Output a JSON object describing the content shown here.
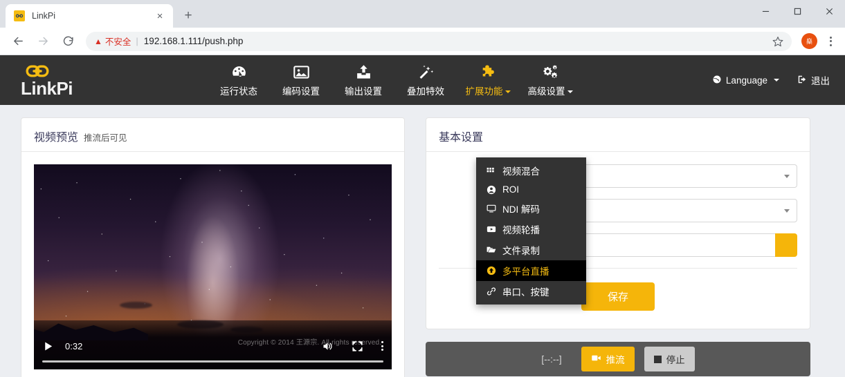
{
  "browser": {
    "tab": {
      "title": "LinkPi",
      "favicon_icon": "link-chain-icon",
      "close_icon": "×"
    },
    "new_tab_label": "+",
    "window": {
      "minimize": "minimize-icon",
      "maximize": "maximize-icon",
      "close": "close-icon"
    },
    "nav": {
      "back": "back-arrow-icon",
      "forward": "forward-arrow-icon",
      "reload": "reload-icon"
    },
    "omnibox": {
      "warning_icon": "warning-triangle-icon",
      "warning_text": "不安全",
      "separator": "|",
      "url": "192.168.1.111/push.php"
    },
    "bookmark_icon": "star-icon",
    "profile_initial": "燊",
    "menu_icon": "kebab-menu-icon"
  },
  "app": {
    "brand": {
      "name": "LinkPi",
      "icon": "chain-link-icon"
    },
    "nav_items": [
      {
        "label": "运行状态",
        "icon": "dashboard-icon",
        "active": false,
        "has_caret": false
      },
      {
        "label": "编码设置",
        "icon": "image-icon",
        "active": false,
        "has_caret": false
      },
      {
        "label": "输出设置",
        "icon": "upload-icon",
        "active": false,
        "has_caret": false
      },
      {
        "label": "叠加特效",
        "icon": "magic-wand-icon",
        "active": false,
        "has_caret": false
      },
      {
        "label": "扩展功能",
        "icon": "puzzle-piece-icon",
        "active": true,
        "has_caret": true
      },
      {
        "label": "高级设置",
        "icon": "gears-icon",
        "active": false,
        "has_caret": true
      }
    ],
    "language": {
      "label": "Language",
      "icon": "globe-icon",
      "has_caret": true
    },
    "logout": {
      "label": "退出",
      "icon": "sign-out-icon"
    },
    "accent_color": "#f5b50a",
    "navbar_color": "#333333",
    "page_bg_color": "#eceef2"
  },
  "dropdown": {
    "items": [
      {
        "label": "视频混合",
        "icon": "grid-icon",
        "selected": false
      },
      {
        "label": "ROI",
        "icon": "user-circle-icon",
        "selected": false
      },
      {
        "label": "NDI 解码",
        "icon": "monitor-icon",
        "selected": false
      },
      {
        "label": "视频轮播",
        "icon": "video-play-icon",
        "selected": false
      },
      {
        "label": "文件录制",
        "icon": "folder-open-icon",
        "selected": false
      },
      {
        "label": "多平台直播",
        "icon": "arrow-circle-up-icon",
        "selected": true
      },
      {
        "label": "串口、按键",
        "icon": "link-icon",
        "selected": false
      }
    ]
  },
  "preview": {
    "title": "视频预览",
    "subtitle": "推流后可见",
    "player": {
      "play_icon": "play-icon",
      "time": "0:32",
      "volume_icon": "volume-icon",
      "fullscreen_icon": "fullscreen-icon",
      "menu_icon": "kebab-menu-icon",
      "watermark": "Copyright © 2014 王源宗. All rights reserved."
    }
  },
  "settings": {
    "title": "基本设置",
    "rows": [
      {
        "label": "",
        "type": "select",
        "value": ""
      },
      {
        "label": "",
        "type": "select",
        "value": ""
      },
      {
        "label": "",
        "type": "input",
        "value": "",
        "button_label": ""
      }
    ],
    "save_label": "保存"
  },
  "statusbar": {
    "clock": "[--:--]",
    "push": {
      "label": "推流",
      "icon": "video-camera-icon"
    },
    "stop": {
      "label": "停止",
      "icon": "stop-square-icon"
    }
  }
}
